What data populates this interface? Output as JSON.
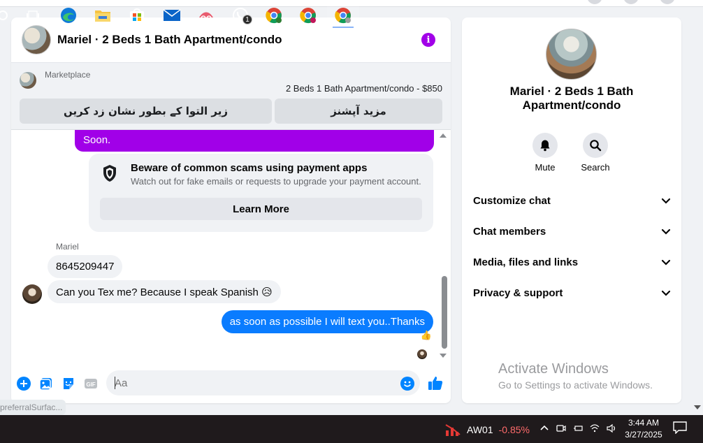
{
  "chat": {
    "title": "Mariel · 2 Beds 1 Bath Apartment/condo",
    "info_icon": "info-icon",
    "marketplace": {
      "label": "Marketplace",
      "listing": "2 Beds 1 Bath Apartment/condo - $850",
      "mark_pending_label": "زیر التوا کے بطور نشان زد کریں",
      "more_options_label": "مزید آپشنز"
    },
    "messages": {
      "outgoing_partial": "Soon.",
      "scam_title": "Beware of common scams using payment apps",
      "scam_desc": "Watch out for fake emails or requests to upgrade your payment account.",
      "learn_more": "Learn More",
      "sender_name": "Mariel",
      "msg_phone": "8645209447",
      "msg_spanish": "Can you Tex me? Because I speak Spanish 😥",
      "msg_out": "as soon as possible I will text you..Thanks",
      "reaction": "👍"
    },
    "composer": {
      "placeholder": "Aa",
      "icons": [
        "plus-circle-icon",
        "image-icon",
        "sticker-icon",
        "gif-icon",
        "emoji-icon",
        "thumbs-up-icon"
      ]
    }
  },
  "side": {
    "title": "Mariel · 2 Beds 1 Bath Apartment/condo",
    "actions": [
      {
        "label": "Mute",
        "icon": "bell-icon"
      },
      {
        "label": "Search",
        "icon": "search-icon"
      }
    ],
    "rows": [
      "Customize chat",
      "Chat members",
      "Media, files and links",
      "Privacy & support"
    ]
  },
  "overlay": {
    "pref_tag": "preferralSurfac...",
    "activate_title": "Activate Windows",
    "activate_sub": "Go to Settings to activate Windows."
  },
  "taskbar": {
    "apps": [
      "task-view-icon",
      "edge-icon",
      "file-explorer-icon",
      "store-icon",
      "mail-icon",
      "snipping-icon",
      "whatsapp-icon",
      "chrome-icon",
      "chrome-profile-icon",
      "chrome-active-icon"
    ],
    "whatsapp_badge": "1",
    "stock_symbol": "AW01",
    "stock_change": "-0.85%",
    "time": "3:44 AM",
    "date": "3/27/2025"
  },
  "colors": {
    "purple": "#a100e8",
    "blue": "#0a7cff",
    "messenger_blue": "#0084ff"
  }
}
